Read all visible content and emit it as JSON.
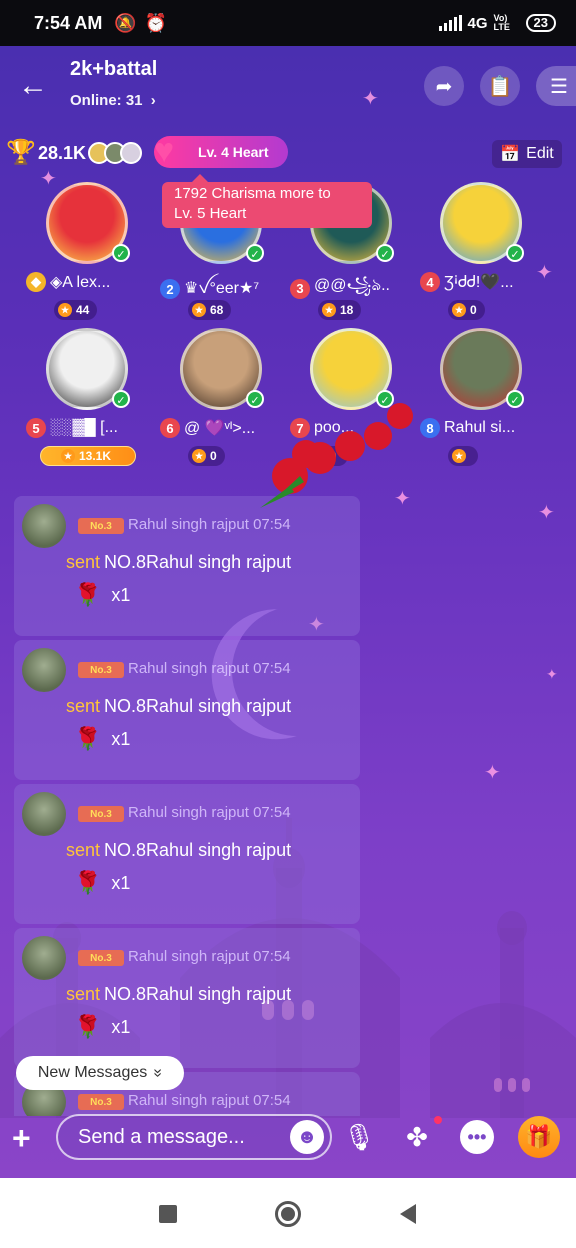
{
  "status_bar": {
    "time": "7:54 AM",
    "network": "4G",
    "volte": "Vo) LTE",
    "battery": "23"
  },
  "header": {
    "title": "2k+battal",
    "online_label": "Online: 31",
    "online_chevron": "›"
  },
  "stats": {
    "score": "28.1K",
    "heart_level": "Lv. 4 Heart",
    "edit_label": "Edit"
  },
  "tooltip": {
    "line1": "1792 Charisma more to",
    "line2": "Lv. 5 Heart"
  },
  "seats": [
    {
      "num": "",
      "name": "◈A lex...",
      "points": "44",
      "num_color": "#f4b52a",
      "av_colors": [
        "#e6323b",
        "#ffd84a"
      ]
    },
    {
      "num": "2",
      "name": "♛ꪜ°eer★⁷",
      "points": "68",
      "num_color": "#3b6ff0",
      "av_colors": [
        "#2a6fe0",
        "#f6c43a"
      ]
    },
    {
      "num": "3",
      "name": "@@꧁ঌ..",
      "points": "18",
      "num_color": "#e8464e",
      "av_colors": [
        "#1f5a57",
        "#f6c43a"
      ]
    },
    {
      "num": "4",
      "name": "ƷꜟᏧᏧ!🖤...",
      "points": "0",
      "num_color": "#e8464e",
      "av_colors": [
        "#f6d23a",
        "#4aa0e8"
      ]
    },
    {
      "num": "5",
      "name": "░░▓█ [...",
      "points": "13.1K",
      "num_color": "#e8464e",
      "av_colors": [
        "#f0f0f0",
        "#202020"
      ]
    },
    {
      "num": "6",
      "name": "@ 💜ᵛᴵ>...",
      "points": "0",
      "num_color": "#e8464e",
      "av_colors": [
        "#c8a07a",
        "#3a2a20"
      ]
    },
    {
      "num": "7",
      "name": "poo...",
      "points": "",
      "num_color": "#e8464e",
      "av_colors": [
        "#f6d23a",
        "#8ac6e8"
      ]
    },
    {
      "num": "8",
      "name": "Rahul si...",
      "points": "",
      "num_color": "#3b6ff0",
      "av_colors": [
        "#6a7a5a",
        "#c23030"
      ]
    }
  ],
  "messages": [
    {
      "badge": "No.3",
      "sender": "Rahul singh rajput 07:54",
      "verb": "sent",
      "text": "NO.8Rahul singh rajput",
      "gift_count": "x1"
    },
    {
      "badge": "No.3",
      "sender": "Rahul singh rajput 07:54",
      "verb": "sent",
      "text": "NO.8Rahul singh rajput",
      "gift_count": "x1"
    },
    {
      "badge": "No.3",
      "sender": "Rahul singh rajput 07:54",
      "verb": "sent",
      "text": "NO.8Rahul singh rajput",
      "gift_count": "x1"
    },
    {
      "badge": "No.3",
      "sender": "Rahul singh rajput 07:54",
      "verb": "sent",
      "text": "NO.8Rahul singh rajput",
      "gift_count": "x1"
    },
    {
      "badge": "No.3",
      "sender": "Rahul singh rajput 07:54",
      "verb": "",
      "text": "",
      "gift_count": ""
    }
  ],
  "new_messages": {
    "label": "New Messages",
    "chevron": "»"
  },
  "input": {
    "placeholder": "Send a message..."
  },
  "colors": {
    "accent": "#ff9a1a",
    "background_top": "#4a2fb0",
    "background_bottom": "#8a45c8",
    "tooltip": "#ec4a72"
  }
}
